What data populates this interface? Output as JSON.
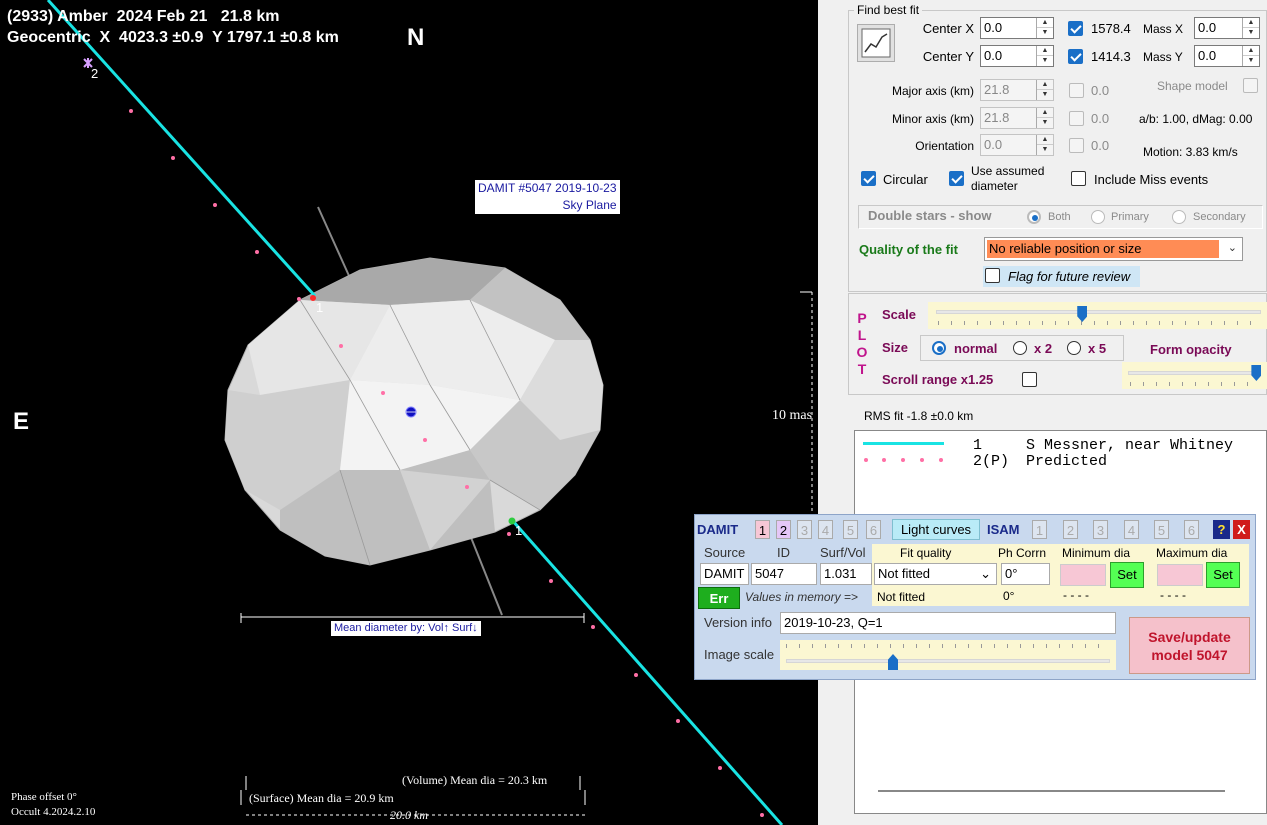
{
  "plot": {
    "title_line1": "(2933) Amber  2024 Feb 21   21.8 km",
    "title_line2": "Geocentric  X  4023.3 ±0.9  Y 1797.1 ±0.8 km",
    "north_label": "N",
    "east_label": "E",
    "damit_label_line1": "DAMIT #5047 2019-10-23",
    "damit_label_line2": "Sky Plane",
    "scale_label": "10 mas",
    "chord_marker_1": "1",
    "chord_marker_2": "1",
    "predicted_marker": "2",
    "mean_diameter_label": "Mean diameter by: Vol↑ Surf↓",
    "volume_mean_dia": "(Volume) Mean dia = 20.3 km",
    "surface_mean_dia": "(Surface) Mean dia = 20.9 km",
    "scale_bar_km": "20.0 km",
    "phase_offset": "Phase offset 0°",
    "version": "Occult 4.2024.2.10",
    "colors": {
      "observed_chord": "#19e3e3",
      "predicted_dots": "#ff6fa6",
      "background": "#000000"
    }
  },
  "fit": {
    "group_title": "Find best fit",
    "center_x_label": "Center X",
    "center_x_value": "0.0",
    "center_y_label": "Center Y",
    "center_y_value": "0.0",
    "x_check_value": "1578.4",
    "y_check_value": "1414.3",
    "mass_x_label": "Mass X",
    "mass_x_value": "0.0",
    "mass_y_label": "Mass Y",
    "mass_y_value": "0.0",
    "major_axis_label": "Major axis (km)",
    "major_axis_value": "21.8",
    "major_check_value": "0.0",
    "minor_axis_label": "Minor axis (km)",
    "minor_axis_value": "21.8",
    "minor_check_value": "0.0",
    "orientation_label": "Orientation",
    "orientation_value": "0.0",
    "orientation_check_value": "0.0",
    "shape_model_label": "Shape model",
    "ab_dmag": "a/b: 1.00, dMag: 0.00",
    "motion": "Motion: 3.83 km/s",
    "circular_label": "Circular",
    "use_assumed_label_1": "Use assumed",
    "use_assumed_label_2": "diameter",
    "include_miss_label": "Include Miss events",
    "double_stars_label": "Double stars - show",
    "both_label": "Both",
    "primary_label": "Primary",
    "secondary_label": "Secondary",
    "quality_label": "Quality of the fit",
    "quality_value": "No reliable position or size",
    "flag_label": "Flag for future review",
    "colors": {
      "quality_bg": "#ff8c55",
      "quality_label": "#1a7a1a",
      "flag_bg": "#cfe6f5"
    }
  },
  "plot_controls": {
    "side_letters": [
      "P",
      "L",
      "O",
      "T"
    ],
    "scale_label": "Scale",
    "size_label": "Size",
    "size_normal": "normal",
    "size_x2": "x 2",
    "size_x5": "x 5",
    "form_opacity_label": "Form opacity",
    "scroll_range_label": "Scroll range x1.25",
    "scale_position": 0.45,
    "opacity_position": 0.98
  },
  "rms_fit": "RMS fit -1.8 ±0.0 km",
  "legend": [
    {
      "num": "1",
      "text": "S Messner, near Whitney"
    },
    {
      "num": "2(P)",
      "text": "Predicted"
    }
  ],
  "damit": {
    "title": "DAMIT",
    "tabs": [
      "1",
      "2",
      "3",
      "4",
      "5",
      "6"
    ],
    "light_curves_label": "Light curves",
    "isam_title": "ISAM",
    "isam_tabs": [
      "1",
      "2",
      "3",
      "4",
      "5",
      "6"
    ],
    "help_label": "?",
    "close_label": "X",
    "source_header": "Source",
    "id_header": "ID",
    "surfvol_header": "Surf/Vol",
    "fit_quality_header": "Fit quality",
    "ph_corr_header": "Ph Corrn",
    "min_dia_header": "Minimum dia",
    "max_dia_header": "Maximum dia",
    "source_value": "DAMIT",
    "id_value": "5047",
    "surfvol_value": "1.031",
    "fit_quality_value": "Not fitted",
    "ph_corr_value": "0°",
    "set_label": "Set",
    "err_label": "Err",
    "values_in_memory_label": "Values in memory =>",
    "memory_fit_quality": "Not fitted",
    "memory_ph_corr": "0°",
    "memory_min_dia": "- - - -",
    "memory_max_dia": "- - - -",
    "version_info_label": "Version info",
    "version_info_value": "2019-10-23, Q=1",
    "image_scale_label": "Image scale",
    "save_label_1": "Save/update",
    "save_label_2": "model 5047",
    "image_scale_position": 0.33
  }
}
